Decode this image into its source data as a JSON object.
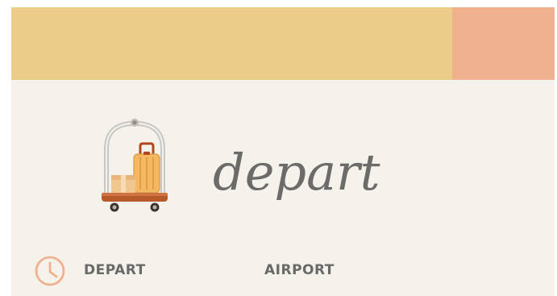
{
  "banner": {
    "left_color": "#ebcd89",
    "right_color": "#f0b18e"
  },
  "hero": {
    "icon": "luggage-cart-icon",
    "headline": "depart"
  },
  "info_row": {
    "icon": "clock-icon",
    "accent_color": "#f0b18e",
    "depart_label": "DEPART",
    "airport_label": "AIRPORT"
  },
  "colors": {
    "background": "#f5f1eb",
    "text": "#6b6967"
  }
}
